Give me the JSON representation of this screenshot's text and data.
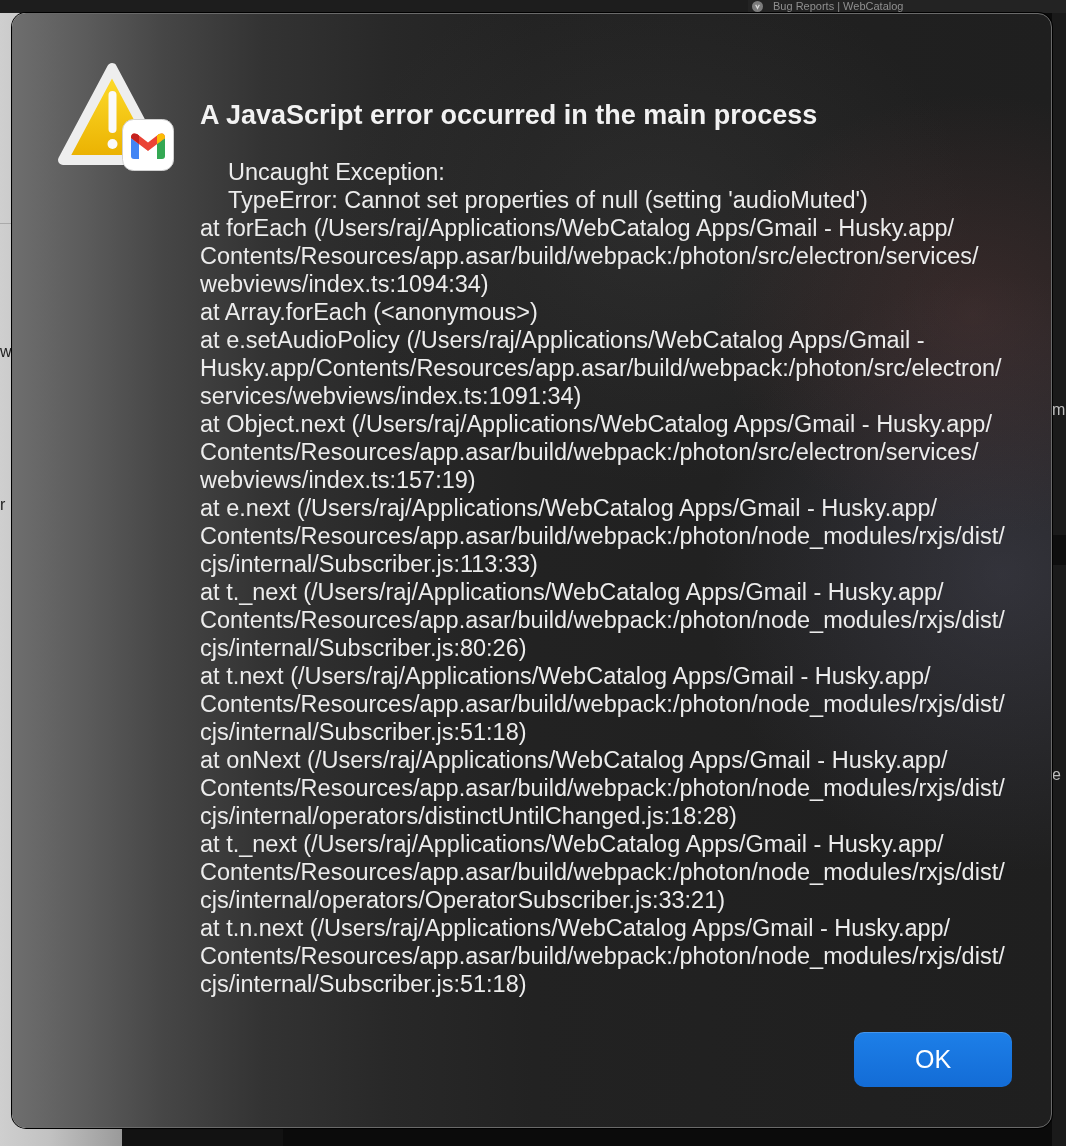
{
  "background": {
    "tab": {
      "title": "Bug Reports | WebCatalog"
    },
    "left_window_text": [
      "w",
      "r"
    ],
    "right_window_text": [
      "m",
      "e"
    ]
  },
  "dialog": {
    "title": "A JavaScript error occurred in the main process",
    "exception": {
      "label": "Uncaught Exception:",
      "error": "TypeError: Cannot set properties of null (setting 'audioMuted')"
    },
    "stack_trace_lines": [
      "at forEach (/Users/raj/Applications/WebCatalog Apps/Gmail - Husky.app/",
      "Contents/Resources/app.asar/build/webpack:/photon/src/electron/services/",
      "webviews/index.ts:1094:34)",
      "at Array.forEach (<anonymous>)",
      "at e.setAudioPolicy (/Users/raj/Applications/WebCatalog Apps/Gmail -",
      "Husky.app/Contents/Resources/app.asar/build/webpack:/photon/src/electron/",
      "services/webviews/index.ts:1091:34)",
      "at Object.next (/Users/raj/Applications/WebCatalog Apps/Gmail - Husky.app/",
      "Contents/Resources/app.asar/build/webpack:/photon/src/electron/services/",
      "webviews/index.ts:157:19)",
      "at e.next (/Users/raj/Applications/WebCatalog Apps/Gmail - Husky.app/",
      "Contents/Resources/app.asar/build/webpack:/photon/node_modules/rxjs/dist/",
      "cjs/internal/Subscriber.js:113:33)",
      "at t._next (/Users/raj/Applications/WebCatalog Apps/Gmail - Husky.app/",
      "Contents/Resources/app.asar/build/webpack:/photon/node_modules/rxjs/dist/",
      "cjs/internal/Subscriber.js:80:26)",
      "at t.next (/Users/raj/Applications/WebCatalog Apps/Gmail - Husky.app/",
      "Contents/Resources/app.asar/build/webpack:/photon/node_modules/rxjs/dist/",
      "cjs/internal/Subscriber.js:51:18)",
      "at onNext (/Users/raj/Applications/WebCatalog Apps/Gmail - Husky.app/",
      "Contents/Resources/app.asar/build/webpack:/photon/node_modules/rxjs/dist/",
      "cjs/internal/operators/distinctUntilChanged.js:18:28)",
      "at t._next (/Users/raj/Applications/WebCatalog Apps/Gmail - Husky.app/",
      "Contents/Resources/app.asar/build/webpack:/photon/node_modules/rxjs/dist/",
      "cjs/internal/operators/OperatorSubscriber.js:33:21)",
      "at t.n.next (/Users/raj/Applications/WebCatalog Apps/Gmail - Husky.app/",
      "Contents/Resources/app.asar/build/webpack:/photon/node_modules/rxjs/dist/",
      "cjs/internal/Subscriber.js:51:18)"
    ],
    "buttons": [
      {
        "label": "OK",
        "default": true
      }
    ]
  }
}
